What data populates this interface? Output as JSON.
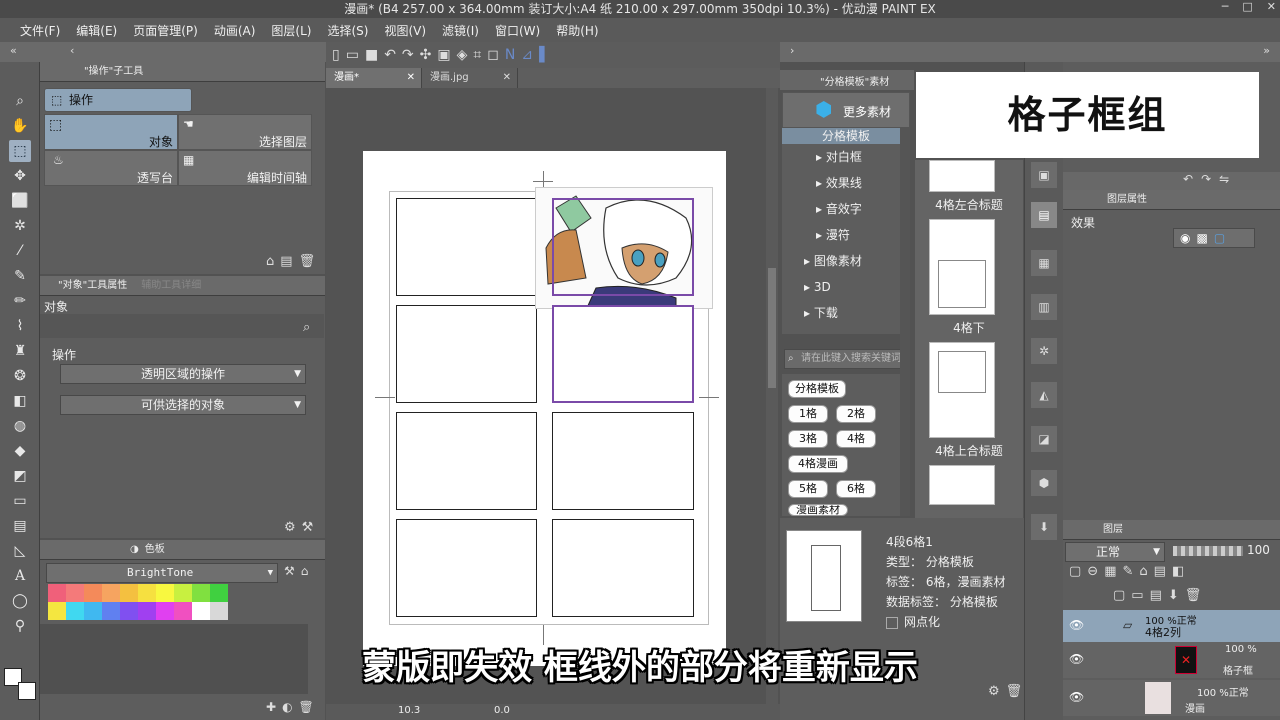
{
  "window": {
    "title": "漫画* (B4 257.00 x 364.00mm 装订大小:A4 纸 210.00 x 297.00mm 350dpi 10.3%) - 优动漫 PAINT EX"
  },
  "menu": [
    "文件(F)",
    "编辑(E)",
    "页面管理(P)",
    "动画(A)",
    "图层(L)",
    "选择(S)",
    "视图(V)",
    "滤镜(I)",
    "窗口(W)",
    "帮助(H)"
  ],
  "tool_panel": {
    "title": "\"操作\"子工具",
    "main_tool": "操作",
    "subtools": [
      "对象",
      "选择图层",
      "透写台",
      "编辑时间轴"
    ]
  },
  "tool_props": {
    "title": "\"对象\"工具属性",
    "title2": "辅助工具详细",
    "section_label": "对象",
    "group_label": "操作",
    "dropdowns": [
      "透明区域的操作",
      "可供选择的对象"
    ]
  },
  "color_panel": {
    "tab": "色板",
    "set_name": "BrightTone",
    "row1": [
      "#f0607a",
      "#f47a7a",
      "#f48a5a",
      "#f6a460",
      "#f4c040",
      "#f6e040",
      "#f8f840",
      "#c8f040",
      "#80e040",
      "#40d040"
    ],
    "row2": [
      "#f4e640",
      "#40d8f0",
      "#40b8f0",
      "#6080f0",
      "#8050f0",
      "#a040f0",
      "#e040f0",
      "#f050c0",
      "#ffffff",
      "#d8d8d8"
    ]
  },
  "document_tabs": [
    "漫画*",
    "漫画.jpg"
  ],
  "canvas": {
    "zoom": "10.3",
    "rotation": "0.0"
  },
  "material_panel": {
    "title": "\"分格模板\"素材",
    "more_button": "更多素材",
    "tree": [
      "分格模板",
      "对白框",
      "效果线",
      "音效字",
      "漫符",
      "图像素材",
      "3D",
      "下载"
    ],
    "search_placeholder": "请在此键入搜索关键词",
    "tags_header": "分格模板",
    "tags": [
      "1格",
      "2格",
      "3格",
      "4格",
      "4格漫画",
      "5格",
      "6格",
      "漫画素材"
    ],
    "thumbnails": [
      "4格左合标题",
      "4格下",
      "4格上合标题"
    ]
  },
  "material_detail": {
    "name": "4段6格1",
    "type": "类型： 分格模板",
    "tags": "标签： 6格，漫画素材",
    "data_tags": "数据标签： 分格模板",
    "halftone": "网点化"
  },
  "layer_props": {
    "title": "图层属性",
    "effect_label": "效果"
  },
  "layers_panel": {
    "tab": "图层",
    "blend_mode": "正常",
    "opacity": "100",
    "layers": [
      {
        "opacity": "100 %正常",
        "name": "4格2列"
      },
      {
        "opacity": "100 %",
        "name": "格子框"
      },
      {
        "opacity": "100 %正常",
        "name": "漫画"
      }
    ]
  },
  "overlay_title": "格子框组",
  "subtitle": "蒙版即失效 框线外的部分将重新显示"
}
